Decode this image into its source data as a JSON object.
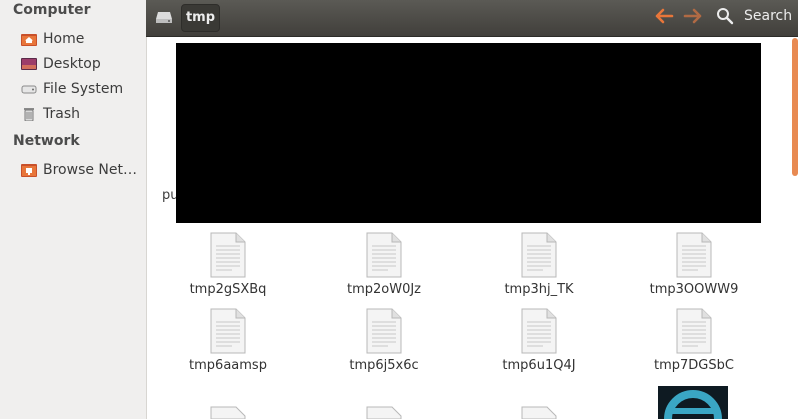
{
  "sidebar": {
    "sections": [
      {
        "heading": "Computer",
        "items": [
          {
            "label": "Home",
            "icon": "home-folder-icon"
          },
          {
            "label": "Desktop",
            "icon": "desktop-icon"
          },
          {
            "label": "File System",
            "icon": "drive-icon"
          },
          {
            "label": "Trash",
            "icon": "trash-icon"
          }
        ]
      },
      {
        "heading": "Network",
        "items": [
          {
            "label": "Browse Net…",
            "icon": "network-icon"
          }
        ]
      }
    ]
  },
  "toolbar": {
    "path": "tmp",
    "search_label": "Search",
    "accent_color": "#e8763a"
  },
  "content": {
    "partial_label": "pu",
    "files": [
      "tmp2gSXBq",
      "tmp2oW0Jz",
      "tmp3hj_TK",
      "tmp3OOWW9",
      "tmp6aamsp",
      "tmp6j5x6c",
      "tmp6u1Q4J",
      "tmp7DGSbC"
    ]
  }
}
